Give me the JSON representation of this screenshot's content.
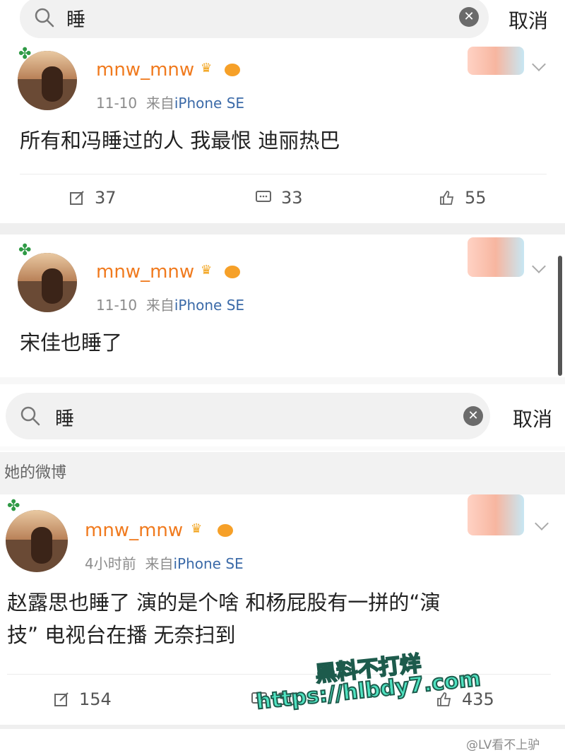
{
  "search1": {
    "query": "睡",
    "cancel": "取消"
  },
  "post1": {
    "username": "mnw_mnw",
    "time": "11-10",
    "source_prefix": "来自",
    "source_device": "iPhone SE",
    "text": "所有和冯睡过的人 我最恨 迪丽热巴",
    "repost_count": "37",
    "comment_count": "33",
    "like_count": "55"
  },
  "post2": {
    "username": "mnw_mnw",
    "time": "11-10",
    "source_prefix": "来自",
    "source_device": "iPhone SE",
    "text": "宋佳也睡了"
  },
  "search2": {
    "query": "睡",
    "cancel": "取消"
  },
  "section": {
    "title": "她的微博"
  },
  "post3": {
    "username": "mnw_mnw",
    "time": "4小时前",
    "source_prefix": "来自",
    "source_device": "iPhone SE",
    "text_line1": "赵露思也睡了 演的是个啥 和杨屁股有一拼的“演",
    "text_line2": "技” 电视台在播 无奈扫到",
    "repost_count": "154",
    "comment_count": "30",
    "like_count": "435"
  },
  "watermark": {
    "line1": "黑料不打烊",
    "line2": "https://hlbdy7.com"
  },
  "weibo_mark": "@LV看不上驴",
  "icons": {
    "search": "search-icon",
    "clear": "clear-icon",
    "repost": "repost-icon",
    "comment": "comment-icon",
    "like": "like-icon",
    "chevron": "chevron-down-icon"
  },
  "colors": {
    "username": "#f07a1e",
    "ip": "#3b6aa8",
    "watermark": "#4fe3c1"
  }
}
